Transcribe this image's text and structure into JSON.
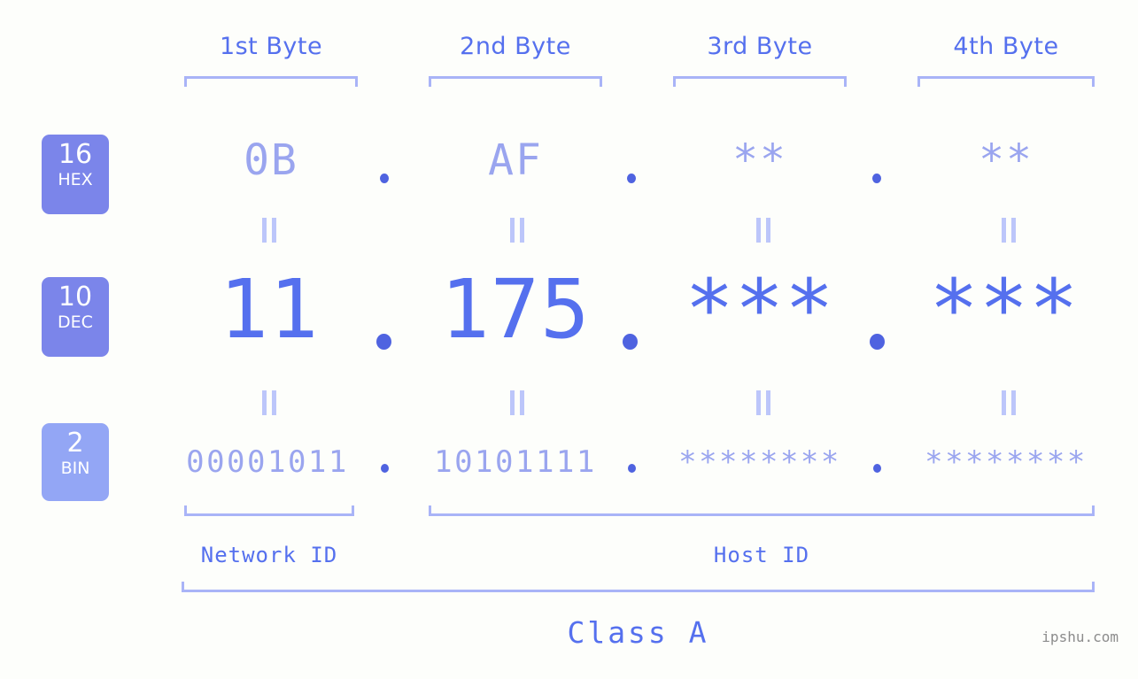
{
  "ip": {
    "address_dec": "11.175.***.***",
    "address_hex": "0B.AF.**.**",
    "address_bin": "00001011.10101111.********.********",
    "class": "Class A",
    "network_id_label": "Network ID",
    "host_id_label": "Host ID"
  },
  "byte_headers": [
    {
      "label": "1st Byte"
    },
    {
      "label": "2nd Byte"
    },
    {
      "label": "3rd Byte"
    },
    {
      "label": "4th Byte"
    }
  ],
  "radix_badges": [
    {
      "number": "16",
      "name": "HEX",
      "color": "#7b85ea"
    },
    {
      "number": "10",
      "name": "DEC",
      "color": "#7b85ea"
    },
    {
      "number": "2",
      "name": "BIN",
      "color": "#93a6f5"
    }
  ],
  "rows": {
    "hex": {
      "values": [
        "0B",
        "AF",
        "**",
        "**"
      ],
      "separator": "."
    },
    "dec": {
      "values": [
        "11",
        "175",
        "***",
        "***"
      ],
      "separator": "."
    },
    "bin": {
      "values": [
        "00001011",
        "10101111",
        "********",
        "********"
      ],
      "separator": "."
    }
  },
  "equivalence_symbol": "=",
  "watermark": "ipshu.com",
  "colors": {
    "background": "#fdfefb",
    "accent_strong": "#5570ee",
    "accent_dot": "#4f63e0",
    "accent_light": "#9aa5ef",
    "bracket": "#a9b4f7",
    "bar": "#bcc6fa",
    "badge_dark": "#7b85ea",
    "badge_light": "#93a6f5",
    "watermark": "#8c8c8c"
  }
}
